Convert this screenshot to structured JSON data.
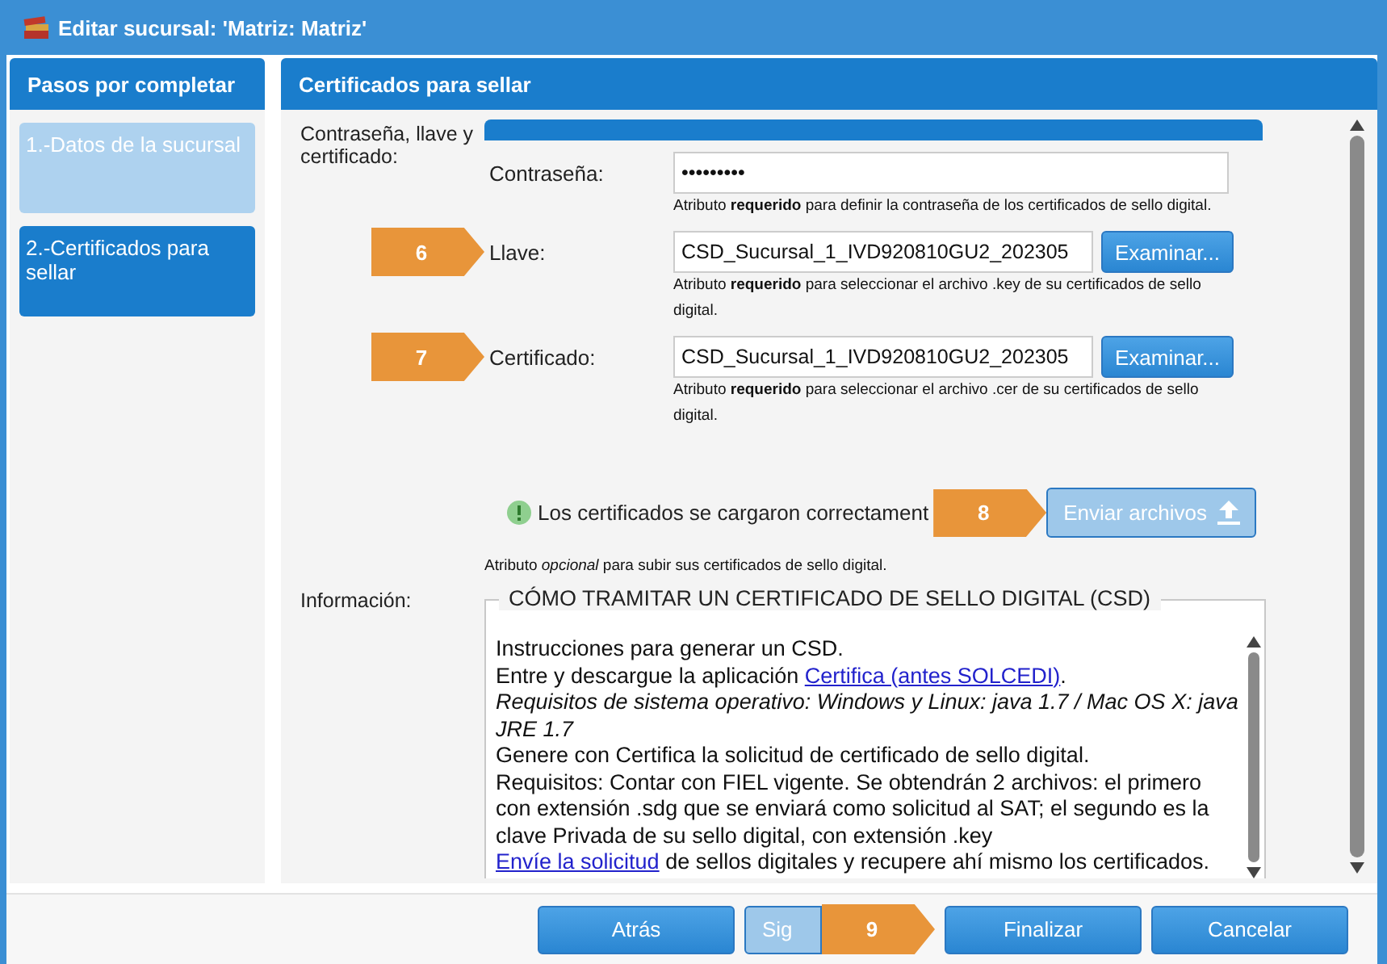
{
  "window": {
    "title": "Editar sucursal: 'Matriz: Matriz'"
  },
  "steps": {
    "title": "Pasos por completar",
    "items": [
      {
        "label": "1.-Datos de la sucursal",
        "selected": false
      },
      {
        "label": "2.-Certificados para sellar",
        "selected": true
      }
    ]
  },
  "section": {
    "title": "Certificados para sellar",
    "group_label": "Contraseña, llave y certificado:",
    "fields": [
      {
        "kind": "password",
        "label": "Contraseña:",
        "value": "•••••••••",
        "hint": "Atributo **requerido** para definir la contraseña de los certificados de sello digital."
      },
      {
        "kind": "file",
        "label": "Llave:",
        "value": "CSD_Sucursal_1_IVD920810GU2_202305",
        "button": "Examinar...",
        "callout": "6",
        "hint": "Atributo **requerido** para seleccionar el archivo .key de su certificados de sello digital."
      },
      {
        "kind": "file",
        "label": "Certificado:",
        "value": "CSD_Sucursal_1_IVD920810GU2_202305",
        "button": "Examinar...",
        "callout": "7",
        "hint": "Atributo **requerido** para seleccionar el archivo .cer de su certificados de sello digital."
      }
    ],
    "upload": {
      "status": "Los certificados se cargaron correctament",
      "callout": "8",
      "button": "Enviar archivos",
      "disabled": true,
      "hint": "Atributo *opcional* para subir sus certificados de sello digital."
    },
    "info": {
      "label": "Información:",
      "legend": "CÓMO TRAMITAR UN CERTIFICADO DE SELLO DIGITAL (CSD)",
      "lines": [
        {
          "kind": "plain",
          "text": "Instrucciones para generar un CSD."
        },
        {
          "kind": "link",
          "before": "Entre y descargue la aplicación ",
          "link": "Certifica (antes SOLCEDI)",
          "after": "."
        },
        {
          "kind": "italic",
          "text": "Requisitos de sistema operativo: Windows y Linux: java 1.7 / Mac OS X: java JRE 1.7"
        },
        {
          "kind": "plain",
          "text": "Genere con Certifica la solicitud de certificado de sello digital."
        },
        {
          "kind": "plain",
          "text": "Requisitos: Contar con FIEL vigente. Se obtendrán 2 archivos: el primero con extensión .sdg que se enviará como solicitud al SAT; el segundo es la clave Privada de su sello digital, con extensión .key"
        },
        {
          "kind": "link",
          "link": "Envíe la solicitud",
          "after": " de sellos digitales y recupere ahí mismo los certificados."
        }
      ]
    }
  },
  "footer": {
    "buttons": [
      {
        "label": "Atrás",
        "disabled": false
      },
      {
        "label": "Sig",
        "disabled": true,
        "callout": "9"
      },
      {
        "label": "Finalizar",
        "disabled": false
      },
      {
        "label": "Cancelar",
        "disabled": false
      }
    ]
  }
}
